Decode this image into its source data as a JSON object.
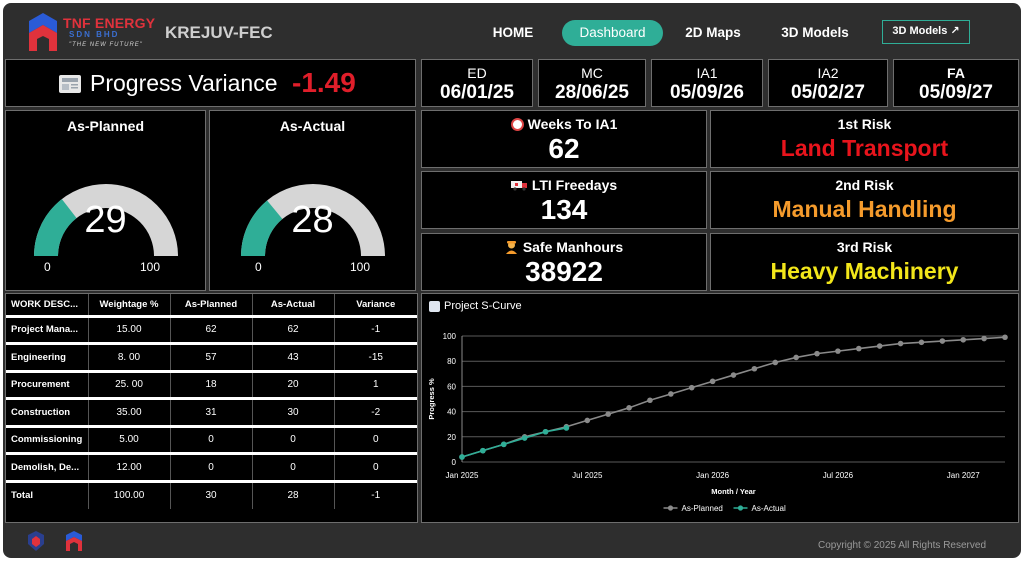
{
  "header": {
    "logo_name": "TNF ENERGY",
    "logo_sub": "SDN BHD",
    "logo_tagline": "\"THE NEW FUTURE\"",
    "project": "KREJUV-FEC",
    "nav": [
      {
        "label": "HOME",
        "active": false
      },
      {
        "label": "Dashboard",
        "active": true
      },
      {
        "label": "2D Maps",
        "active": false
      },
      {
        "label": "3D Models",
        "active": false
      },
      {
        "label": "3D Models ↗",
        "active": false
      }
    ]
  },
  "progress_variance": {
    "label": "Progress Variance",
    "value": "-1.49"
  },
  "milestones": [
    {
      "label": "ED",
      "date": "06/01/25"
    },
    {
      "label": "MC",
      "date": "28/06/25"
    },
    {
      "label": "IA1",
      "date": "05/09/26"
    },
    {
      "label": "IA2",
      "date": "05/02/27"
    },
    {
      "label": "FA",
      "date": "05/09/27"
    }
  ],
  "gauges": [
    {
      "title": "As-Planned",
      "value": 29,
      "display": "29",
      "min": "0",
      "max": "100"
    },
    {
      "title": "As-Actual",
      "value": 28,
      "display": "28",
      "min": "0",
      "max": "100"
    }
  ],
  "kpis": [
    {
      "icon": "clock-icon",
      "label": "Weeks To IA1",
      "value": "62"
    },
    {
      "icon": "ambulance-icon",
      "label": "LTI Freedays",
      "value": "134"
    },
    {
      "icon": "worker-icon",
      "label": "Safe Manhours",
      "value": "38922"
    }
  ],
  "risks": [
    {
      "label": "1st Risk",
      "value": "Land Transport",
      "color": "#e8141c"
    },
    {
      "label": "2nd Risk",
      "value": "Manual Handling",
      "color": "#f59b2c"
    },
    {
      "label": "3rd Risk",
      "value": "Heavy Machinery",
      "color": "#f2e61a"
    }
  ],
  "table": {
    "headers": [
      "WORK DESC...",
      "Weightage %",
      "As-Planned",
      "As-Actual",
      "Variance"
    ],
    "rows": [
      [
        "Project Mana...",
        "15.00",
        "62",
        "62",
        "-1"
      ],
      [
        "Engineering",
        "8. 00",
        "57",
        "43",
        "-15"
      ],
      [
        "Procurement",
        "25. 00",
        "18",
        "20",
        "1"
      ],
      [
        "Construction",
        "35.00",
        "31",
        "30",
        "-2"
      ],
      [
        "Commissioning",
        "5.00",
        "0",
        "0",
        "0"
      ],
      [
        "Demolish, De...",
        "12.00",
        "0",
        "0",
        "0"
      ],
      [
        "Total",
        "100.00",
        "30",
        "28",
        "-1"
      ]
    ]
  },
  "chart_data": {
    "type": "line",
    "title": "Project S-Curve",
    "xlabel": "Month / Year",
    "ylabel": "Progress %",
    "ylim": [
      0,
      100
    ],
    "y_ticks": [
      0,
      20,
      40,
      60,
      80,
      100
    ],
    "x_ticks": [
      "Jan 2025",
      "Jul 2025",
      "Jan 2026",
      "Jul 2026",
      "Jan 2027"
    ],
    "grid": true,
    "legend": "bottom",
    "series": [
      {
        "name": "As-Planned",
        "color": "#8a8a8a",
        "x": [
          "2025-01",
          "2025-02",
          "2025-03",
          "2025-04",
          "2025-05",
          "2025-06",
          "2025-07",
          "2025-08",
          "2025-09",
          "2025-10",
          "2025-11",
          "2025-12",
          "2026-01",
          "2026-02",
          "2026-03",
          "2026-04",
          "2026-05",
          "2026-06",
          "2026-07",
          "2026-08",
          "2026-09",
          "2026-10",
          "2026-11",
          "2026-12",
          "2027-01",
          "2027-02",
          "2027-03"
        ],
        "values": [
          4,
          9,
          14,
          20,
          24,
          28,
          33,
          38,
          43,
          49,
          54,
          59,
          64,
          69,
          74,
          79,
          83,
          86,
          88,
          90,
          92,
          94,
          95,
          96,
          97,
          98,
          99
        ]
      },
      {
        "name": "As-Actual",
        "color": "#2fae97",
        "x": [
          "2025-01",
          "2025-02",
          "2025-03",
          "2025-04",
          "2025-05",
          "2025-06"
        ],
        "values": [
          4,
          9,
          14,
          19,
          24,
          27
        ]
      }
    ]
  },
  "footer": {
    "copyright": "Copyright © 2025 All Rights Reserved"
  }
}
